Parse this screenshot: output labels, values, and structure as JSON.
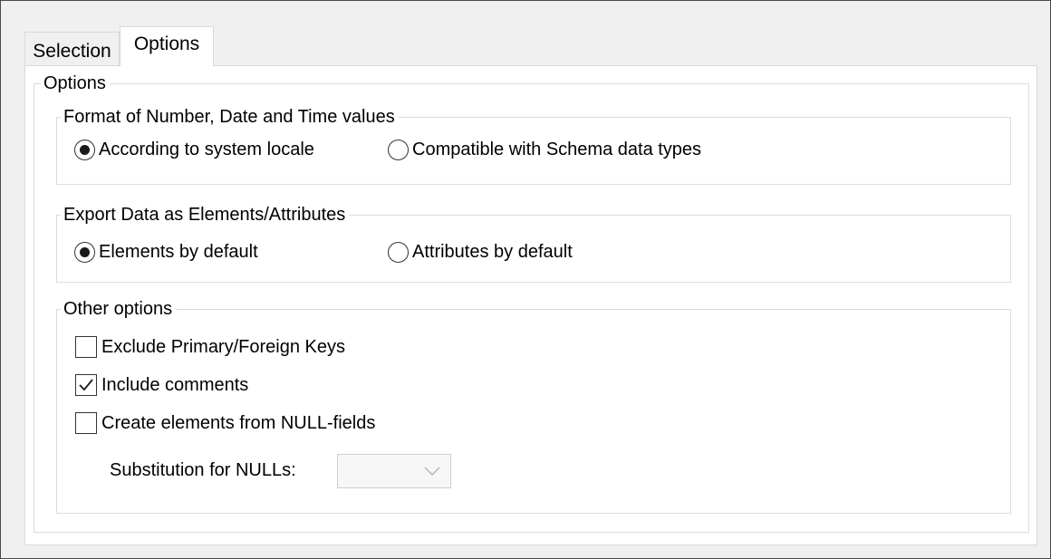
{
  "tabs": [
    {
      "label": "Selection",
      "active": false
    },
    {
      "label": "Options",
      "active": true
    }
  ],
  "options_group": {
    "title": "Options",
    "format_group": {
      "title": "Format of Number, Date and Time values",
      "radio_system_locale": {
        "label": "According to system locale",
        "checked": true
      },
      "radio_schema_types": {
        "label": "Compatible with Schema data types",
        "checked": false
      }
    },
    "export_group": {
      "title": "Export Data as Elements/Attributes",
      "radio_elements": {
        "label": "Elements by default",
        "checked": true
      },
      "radio_attributes": {
        "label": "Attributes by default",
        "checked": false
      }
    },
    "other_group": {
      "title": "Other options",
      "check_exclude_keys": {
        "label": "Exclude Primary/Foreign Keys",
        "checked": false
      },
      "check_include_comments": {
        "label": "Include comments",
        "checked": true
      },
      "check_null_fields": {
        "label": "Create elements from NULL-fields",
        "checked": false
      },
      "substitution_label": "Substitution for NULLs:",
      "substitution_value": "",
      "substitution_enabled": false
    }
  },
  "icons": {
    "checkmark": "checkmark-icon",
    "dropdown": "chevron-down-icon"
  },
  "colors": {
    "dialog_bg": "#f0f0f0",
    "page_bg": "#ffffff",
    "group_border": "#dcdcdc",
    "disabled_chevron": "#b5b5b5"
  }
}
